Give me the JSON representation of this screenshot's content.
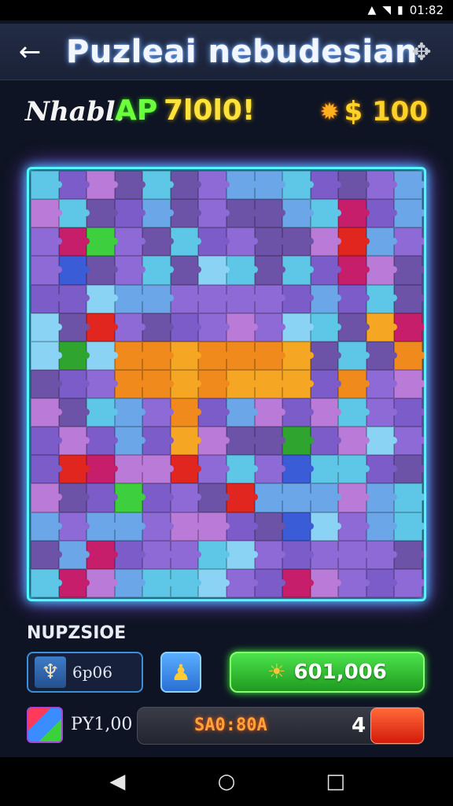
{
  "status_bar": {
    "time": "01:82"
  },
  "header": {
    "title": "Puzleai nebudesian"
  },
  "stats": {
    "player_label": "Nhabl.",
    "ap_label": "AP",
    "ap_value": "7l0l0!",
    "coins": "$ 100"
  },
  "section": {
    "label": "NUPZSIOE"
  },
  "items": {
    "item_text": "6p06",
    "green_button_text": "601,006"
  },
  "bottom": {
    "row_text": "PY1,00",
    "progress_text": "SA0:80A",
    "progress_count": "4"
  },
  "colors": {
    "frame_glow": "#55f2ff",
    "accent_green": "#4ce34c",
    "accent_red": "#d41a0a",
    "coin_gold": "#ffd22a"
  },
  "icons": {
    "back": "back-arrow-icon",
    "settings": "gear-icon",
    "coin": "gear-coin-icon",
    "item": "tooth-icon",
    "pawn": "pawn-icon",
    "sun": "sun-icon",
    "cube": "cube-icon"
  },
  "puzzle": {
    "palette": [
      "#7b5cc9",
      "#8e6ad6",
      "#6aa6e8",
      "#5ec6e6",
      "#3ecf3e",
      "#2fa52f",
      "#f5a623",
      "#f08a1c",
      "#e0261e",
      "#c61e6a",
      "#3a5cd6",
      "#8bd3f5",
      "#b97ad8",
      "#6c53a8"
    ]
  }
}
